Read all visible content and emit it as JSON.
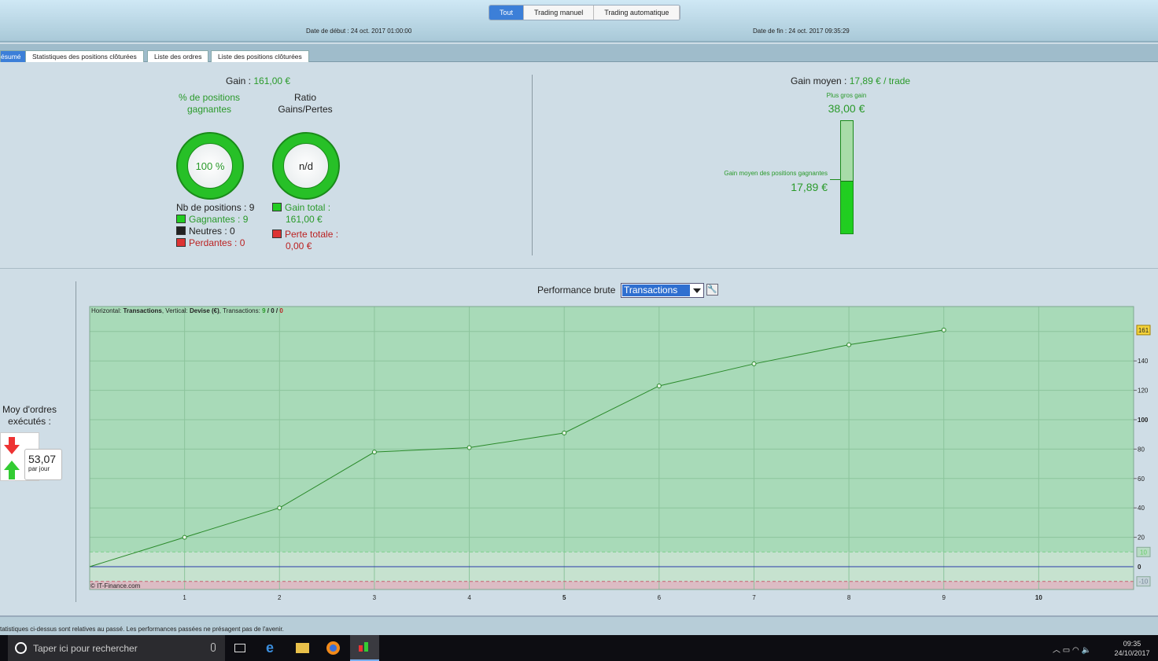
{
  "header": {
    "mode_buttons": [
      "Tout",
      "Trading manuel",
      "Trading automatique"
    ],
    "start_date": "Date de début :  24 oct. 2017 01:00:00",
    "end_date": "Date de fin :  24 oct. 2017 09:35:29"
  },
  "tabs": [
    "ésumé",
    "Statistiques des positions clôturées",
    "Liste des ordres",
    "Liste des positions clôturées"
  ],
  "summary": {
    "gain_label": "Gain :",
    "gain_value": "161,00 €",
    "pct_title": "% de positions gagnantes",
    "pct_value": "100 %",
    "ratio_title": "Ratio Gains/Pertes",
    "ratio_value": "n/d",
    "nb_positions": "Nb de positions : 9",
    "gagnantes": "Gagnantes : 9",
    "neutres": "Neutres : 0",
    "perdantes": "Perdantes : 0",
    "gain_total_label": "Gain total :",
    "gain_total_value": "161,00 €",
    "perte_totale_label": "Perte totale :",
    "perte_totale_value": "0,00 €",
    "gain_moyen_label": "Gain moyen :",
    "gain_moyen_value": "17,89 € / trade",
    "plus_gros_gain_label": "Plus gros gain",
    "plus_gros_gain_value": "38,00 €",
    "gain_moyen_gagnantes_label": "Gain moyen des positions gagnantes",
    "gain_moyen_gagnantes_value": "17,89 €",
    "bar_fill_fraction": 0.4708
  },
  "left_panel": {
    "title": "Moy d'ordres exécutés :",
    "value": "53,07",
    "unit": "par jour"
  },
  "performance": {
    "label": "Performance brute",
    "select_value": "Transactions"
  },
  "chart_data": {
    "type": "line",
    "info": {
      "h_label": "Horizontal:",
      "h_value": "Transactions",
      "v_label": "Vertical:",
      "v_value": "Devise (€)",
      "t_label": "Transactions:",
      "won": "9",
      "neutral": "0",
      "lost": "0"
    },
    "x": [
      0,
      1,
      2,
      3,
      4,
      5,
      6,
      7,
      8,
      9
    ],
    "values": [
      0,
      20,
      40,
      78,
      81,
      91,
      123,
      138,
      151,
      161
    ],
    "xlim": [
      0,
      11
    ],
    "ylim": [
      -15.5,
      177
    ],
    "x_ticks": [
      1,
      2,
      3,
      4,
      5,
      6,
      7,
      8,
      9,
      10
    ],
    "y_ticks": [
      0,
      20,
      40,
      60,
      80,
      100,
      120,
      140
    ],
    "last_value_label": "161",
    "upper_threshold": "10",
    "lower_threshold": "-10",
    "watermark": "© IT-Finance.com",
    "grid": true,
    "colors": {
      "line": "#2a8a2a",
      "upper_zone": "#a8dab8",
      "mid_zone": "#c6e2cf",
      "lower_zone": "#dcbcc4",
      "zero_line": "#2a3aa8"
    }
  },
  "footer": {
    "disclaimer": "tatistiques ci-dessus sont relatives au passé. Les performances passées ne présagent pas de l'avenir."
  },
  "taskbar": {
    "search_placeholder": "Taper ici pour rechercher",
    "time": "09:35",
    "date": "24/10/2017"
  }
}
